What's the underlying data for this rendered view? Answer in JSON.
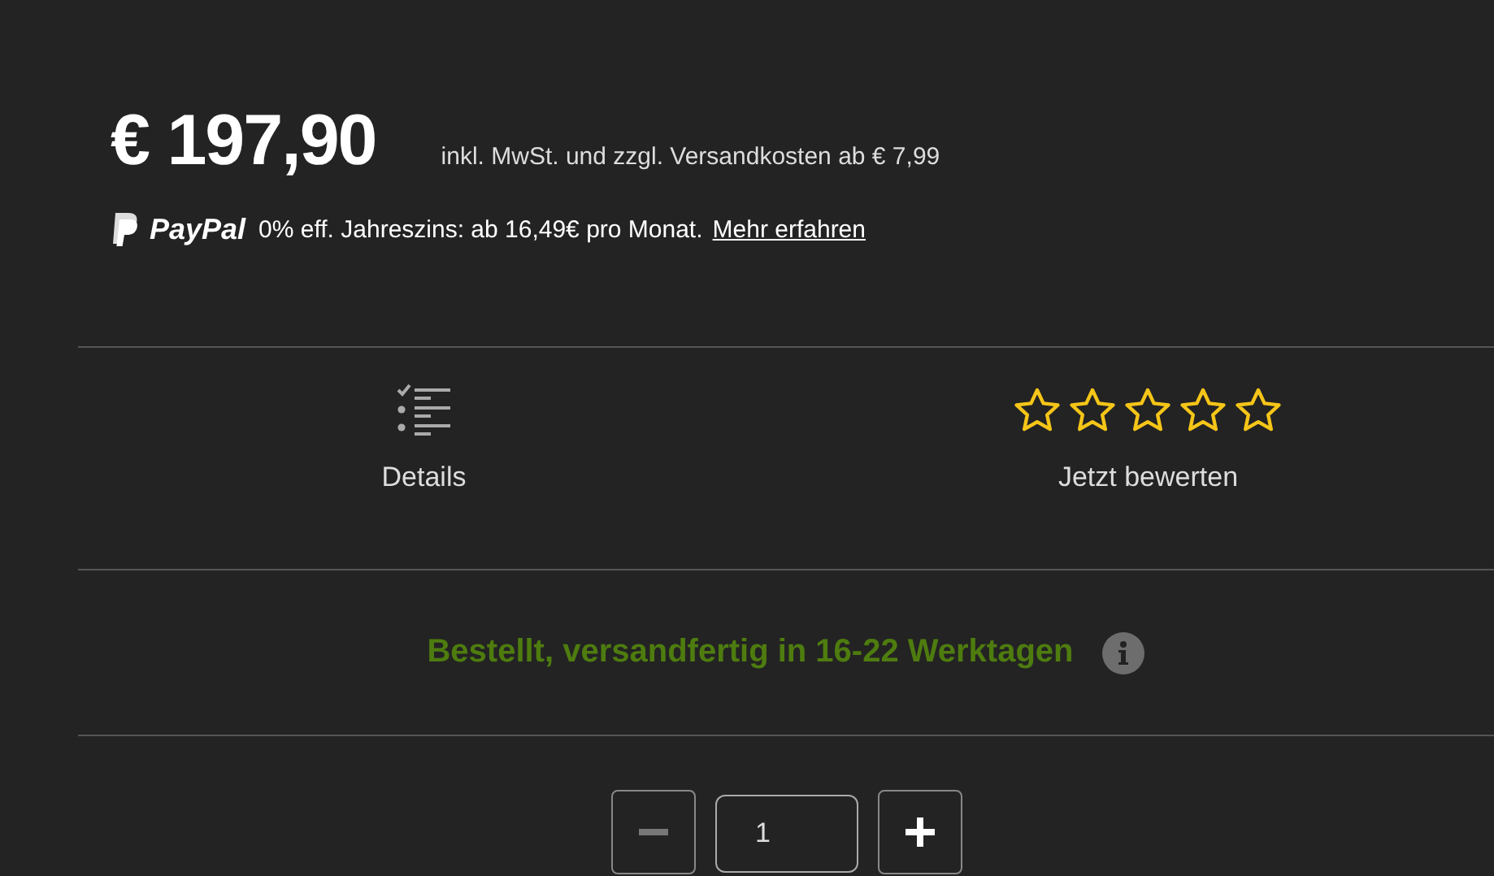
{
  "price": {
    "amount": "€ 197,90",
    "note": "inkl. MwSt. und zzgl. Versandkosten ab € 7,99"
  },
  "paypal": {
    "brand": "PayPal",
    "text": "0% eff. Jahreszins: ab 16,49€ pro Monat.",
    "link": "Mehr erfahren"
  },
  "details": {
    "label": "Details"
  },
  "rating": {
    "stars": 0,
    "label": "Jetzt bewerten"
  },
  "availability": {
    "text": "Bestellt, versandfertig in 16-22 Werktagen"
  },
  "quantity": {
    "value": "1",
    "minus_disabled": true,
    "plus_disabled": false
  }
}
